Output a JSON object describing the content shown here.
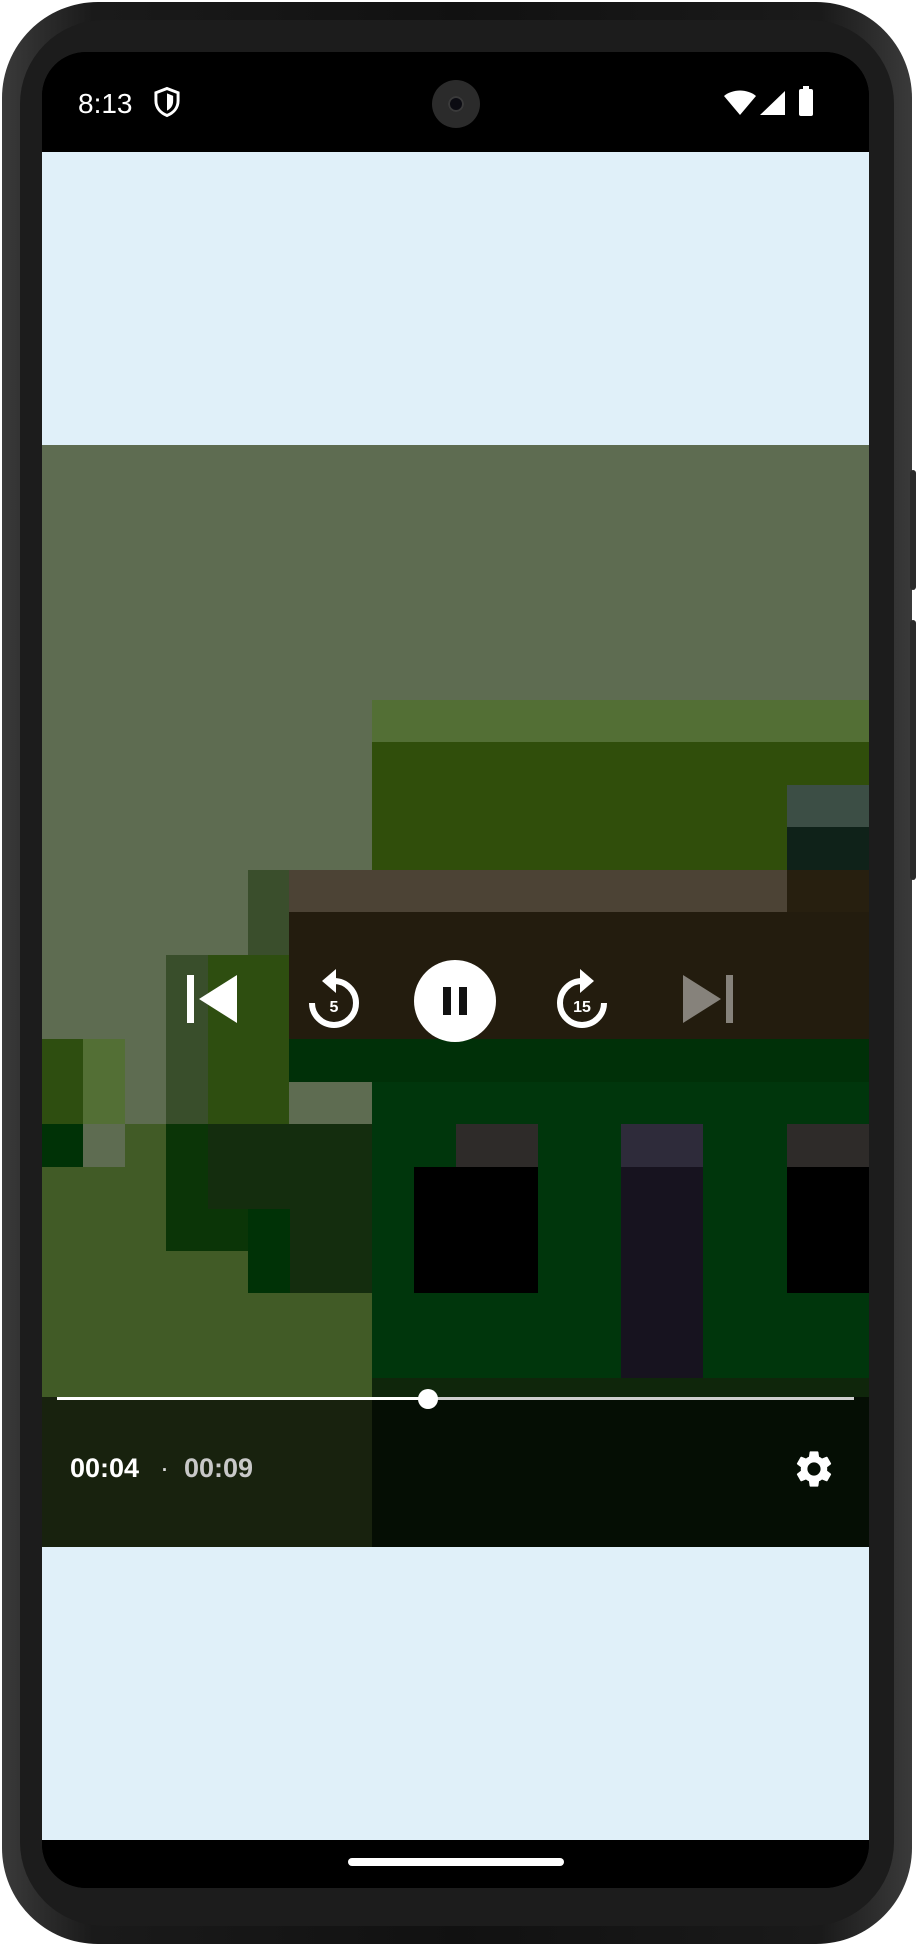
{
  "status_bar": {
    "time": "8:13",
    "icons": [
      "shield-icon",
      "wifi-icon",
      "signal-icon",
      "battery-icon"
    ]
  },
  "player": {
    "controls": {
      "previous": "skip-previous-icon",
      "rewind_label": "5",
      "play_pause": "pause-icon",
      "forward_label": "15",
      "next": "skip-next-icon"
    },
    "position": "00:04",
    "separator": "·",
    "duration": "00:09",
    "progress_fraction": 0.465,
    "settings": "settings-gear-icon"
  },
  "colors": {
    "app_background": "#e0f0f9",
    "accent": "#ffffff"
  }
}
